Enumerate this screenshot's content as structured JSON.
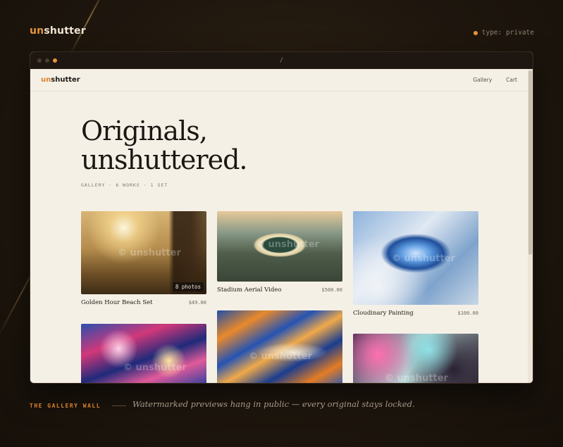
{
  "brand": {
    "prefix": "un",
    "suffix": "shutter"
  },
  "type_tag": "type: private",
  "browser": {
    "url": "/"
  },
  "site": {
    "logo_prefix": "un",
    "logo_suffix": "shutter",
    "nav": [
      {
        "label": "Gallery"
      },
      {
        "label": "Cart"
      }
    ]
  },
  "hero": {
    "line1": "Originals,",
    "line2": "unshuttered.",
    "meta": [
      "GALLERY",
      "·",
      "6 WORKS",
      "·",
      "1 SET"
    ]
  },
  "watermark": "© unshutter",
  "cards": [
    {
      "title": "Golden Hour Beach Set",
      "price": "$49.00",
      "badge": "8 photos"
    },
    {
      "title": "Stadium Aerial Video",
      "price": "$500.00"
    },
    {
      "title": "Cloudinary Painting",
      "price": "$100.00"
    },
    {
      "title": ""
    },
    {
      "title": ""
    },
    {
      "title": ""
    }
  ],
  "footer": {
    "label": "THE GALLERY WALL",
    "text": "Watermarked previews hang in public — every original stays locked."
  },
  "colors": {
    "accent": "#e6953b",
    "page_bg": "#f5f0e6",
    "dark_bg": "#1f170e"
  }
}
